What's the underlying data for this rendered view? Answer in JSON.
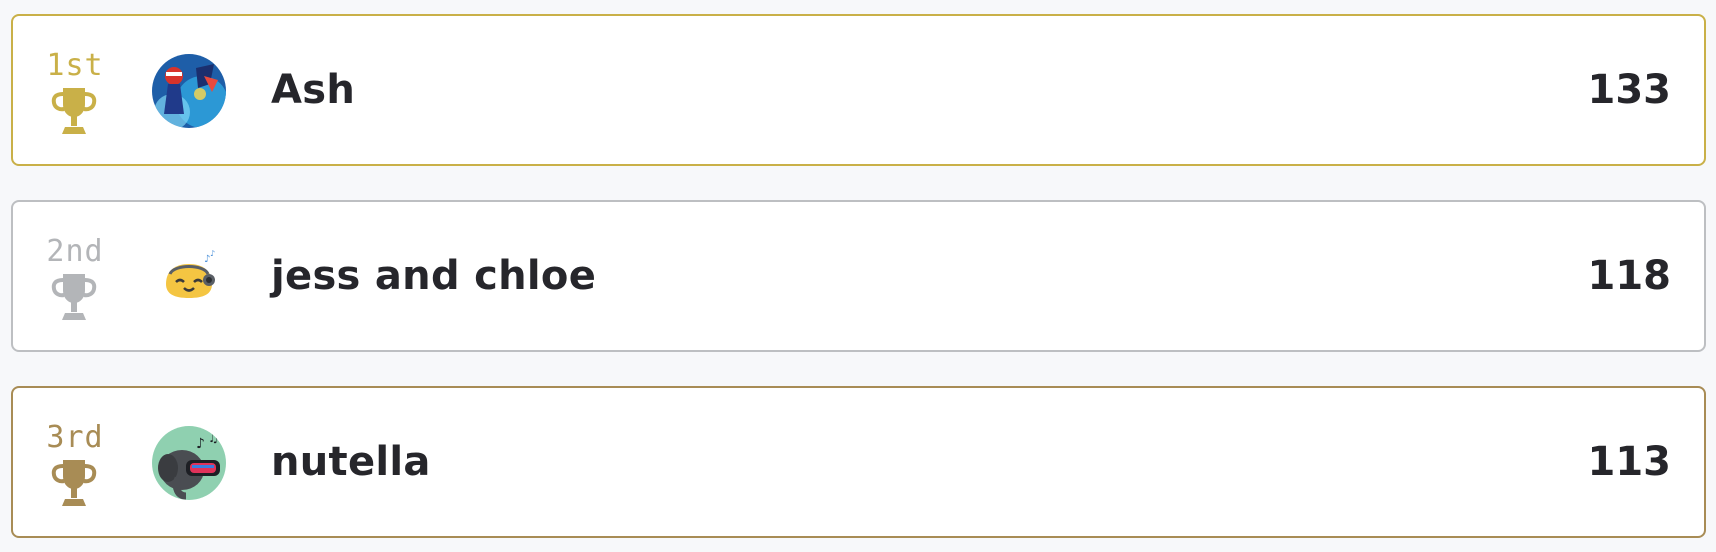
{
  "leaderboard": [
    {
      "rank_label": "1st",
      "rank_color": "#c9b048",
      "name": "Ash",
      "score": "133",
      "avatar": "trainer-avatar",
      "trophy": "gold-trophy-icon"
    },
    {
      "rank_label": "2nd",
      "rank_color": "#b3b5b8",
      "name": "jess and chloe",
      "score": "118",
      "avatar": "music-emoji-avatar",
      "trophy": "silver-trophy-icon"
    },
    {
      "rank_label": "3rd",
      "rank_color": "#a88c55",
      "name": "nutella",
      "score": "113",
      "avatar": "elephant-avatar",
      "trophy": "bronze-trophy-icon"
    }
  ]
}
